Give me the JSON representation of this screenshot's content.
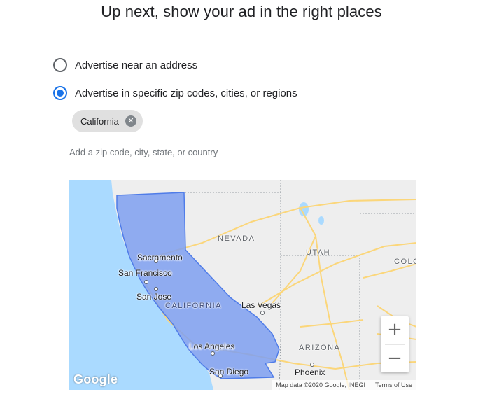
{
  "heading": "Up next, show your ad in the right places",
  "options": [
    {
      "label": "Advertise near an address",
      "checked": false
    },
    {
      "label": "Advertise in specific zip codes, cities, or regions",
      "checked": true
    }
  ],
  "chip": {
    "label": "California",
    "close": "✕"
  },
  "search": {
    "placeholder": "Add a zip code, city, state, or country",
    "value": ""
  },
  "map": {
    "states": {
      "nevada": "NEVADA",
      "utah": "UTAH",
      "colorado": "COLO",
      "california": "CALIFORNIA",
      "arizona": "ARIZONA"
    },
    "cities": {
      "sacramento": "Sacramento",
      "san_francisco": "San Francisco",
      "san_jose": "San Jose",
      "las_vegas": "Las Vegas",
      "los_angeles": "Los Angeles",
      "san_diego": "San Diego",
      "phoenix": "Phoenix"
    },
    "zoom_in": "+",
    "zoom_out": "−",
    "logo": "Google",
    "attribution": "Map data ©2020 Google, INEGI",
    "terms": "Terms of Use",
    "colors": {
      "water": "#aadaff",
      "land": "#eeeeee",
      "region_fill": "#7e9ff0",
      "region_stroke": "#4f7ce8",
      "road": "#fbd67a"
    }
  }
}
